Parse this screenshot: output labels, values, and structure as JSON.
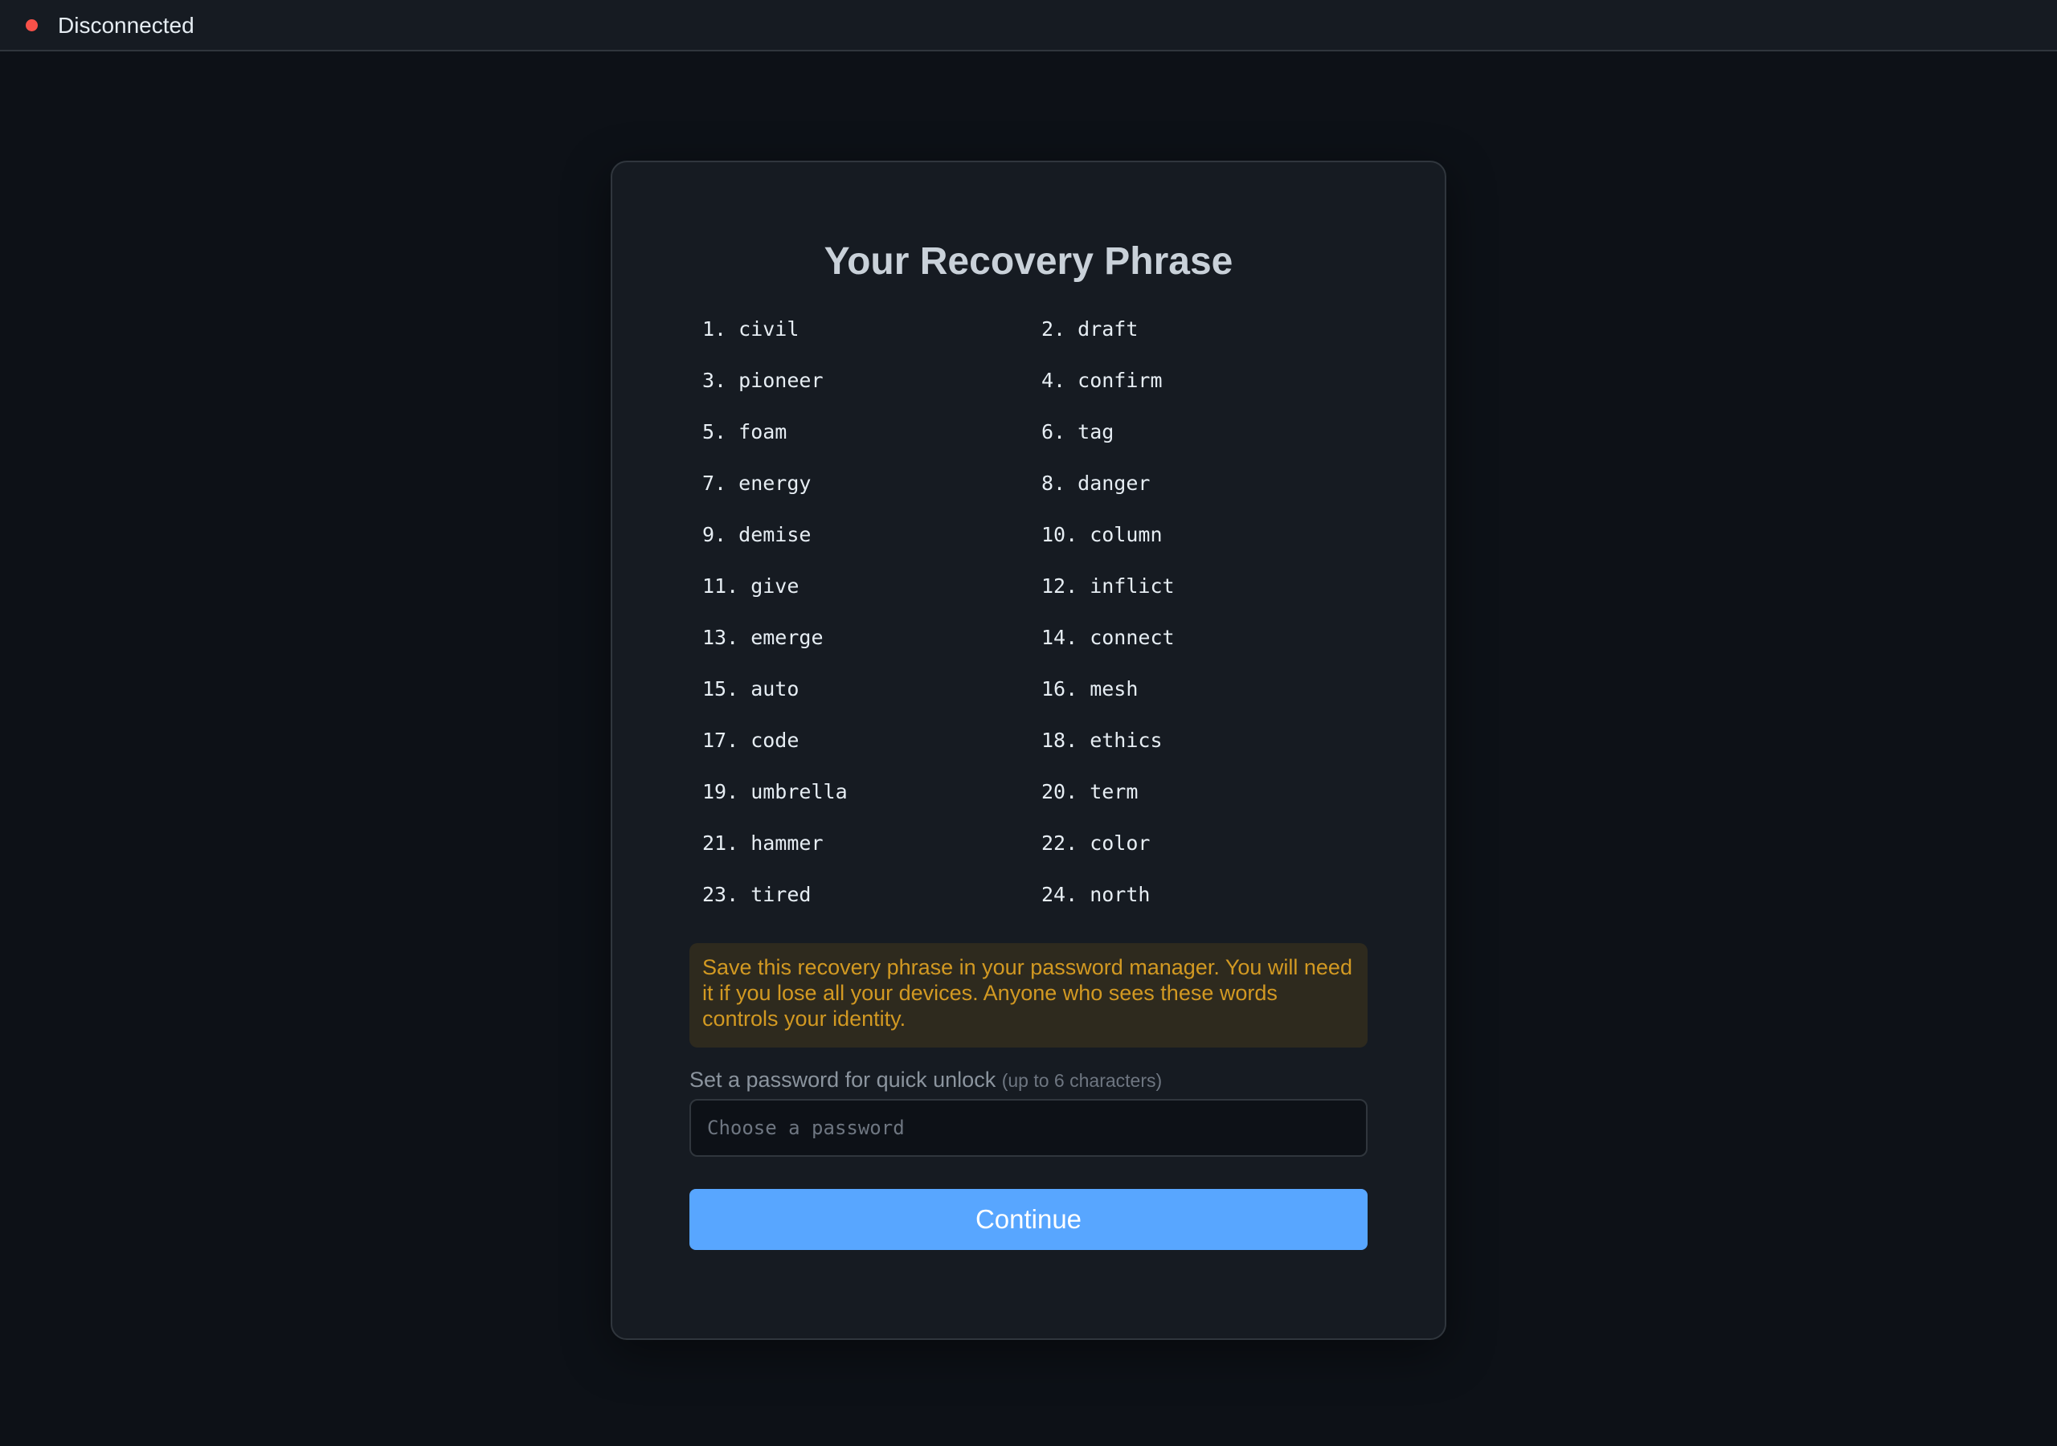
{
  "status": {
    "text": "Disconnected",
    "color": "#f85149",
    "icon": "status-dot-icon"
  },
  "card": {
    "title": "Your Recovery Phrase",
    "words": [
      {
        "num": "1.",
        "word": "civil"
      },
      {
        "num": "2.",
        "word": "draft"
      },
      {
        "num": "3.",
        "word": "pioneer"
      },
      {
        "num": "4.",
        "word": "confirm"
      },
      {
        "num": "5.",
        "word": "foam"
      },
      {
        "num": "6.",
        "word": "tag"
      },
      {
        "num": "7.",
        "word": "energy"
      },
      {
        "num": "8.",
        "word": "danger"
      },
      {
        "num": "9.",
        "word": "demise"
      },
      {
        "num": "10.",
        "word": "column"
      },
      {
        "num": "11.",
        "word": "give"
      },
      {
        "num": "12.",
        "word": "inflict"
      },
      {
        "num": "13.",
        "word": "emerge"
      },
      {
        "num": "14.",
        "word": "connect"
      },
      {
        "num": "15.",
        "word": "auto"
      },
      {
        "num": "16.",
        "word": "mesh"
      },
      {
        "num": "17.",
        "word": "code"
      },
      {
        "num": "18.",
        "word": "ethics"
      },
      {
        "num": "19.",
        "word": "umbrella"
      },
      {
        "num": "20.",
        "word": "term"
      },
      {
        "num": "21.",
        "word": "hammer"
      },
      {
        "num": "22.",
        "word": "color"
      },
      {
        "num": "23.",
        "word": "tired"
      },
      {
        "num": "24.",
        "word": "north"
      }
    ],
    "warning": "Save this recovery phrase in your password manager. You will need it if you lose all your devices. Anyone who sees these words controls your identity.",
    "password_label": "Set a password for quick unlock",
    "password_hint": "(up to 6 characters)",
    "password_placeholder": "Choose a password",
    "password_value": "",
    "continue_label": "Continue"
  },
  "colors": {
    "background": "#0d1117",
    "card": "#161b22",
    "accent": "#58a6ff",
    "warning_text": "#d29922",
    "warning_bg": "#2e2a1e"
  }
}
